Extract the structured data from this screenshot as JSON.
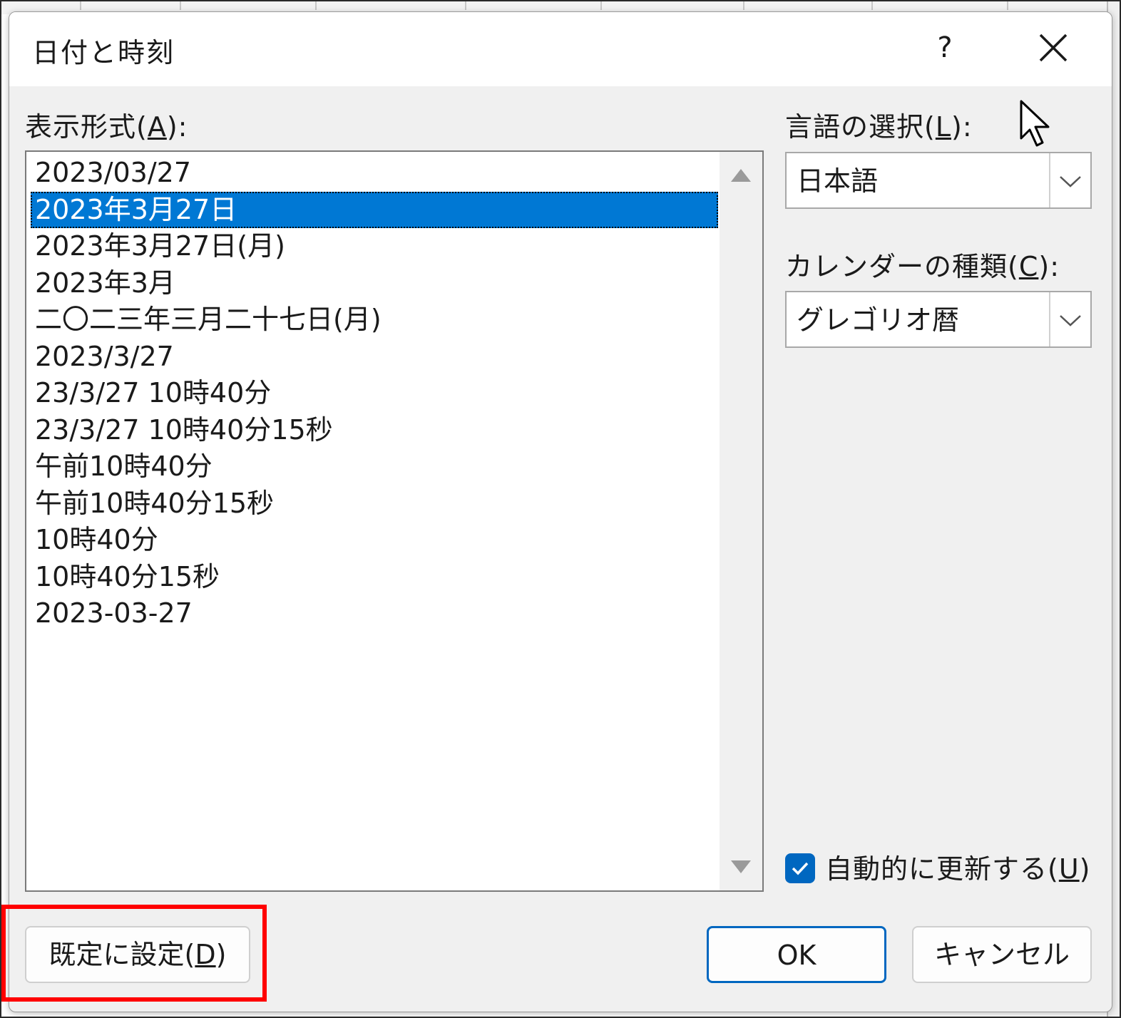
{
  "dialog": {
    "title": "日付と時刻",
    "help_label": "?"
  },
  "format_section": {
    "label_text": "表示形式(",
    "label_key": "A",
    "label_end": "):",
    "items": [
      "2023/03/27",
      "2023年3月27日",
      "2023年3月27日(月)",
      "2023年3月",
      "二〇二三年三月二十七日(月)",
      "2023/3/27",
      "23/3/27 10時40分",
      "23/3/27 10時40分15秒",
      "午前10時40分",
      "午前10時40分15秒",
      "10時40分",
      "10時40分15秒",
      "2023-03-27"
    ],
    "selected_index": 1
  },
  "language": {
    "label_text": "言語の選択(",
    "label_key": "L",
    "label_end": "):",
    "value": "日本語"
  },
  "calendar": {
    "label_text": "カレンダーの種類(",
    "label_key": "C",
    "label_end": "):",
    "value": "グレゴリオ暦"
  },
  "auto_update": {
    "label_text": "自動的に更新する(",
    "label_key": "U",
    "label_end": ")",
    "checked": true
  },
  "buttons": {
    "default_text": "既定に設定(",
    "default_key": "D",
    "default_end": ")",
    "ok": "OK",
    "cancel": "キャンセル"
  },
  "colors": {
    "selection": "#0078d4",
    "accent": "#0067c0",
    "highlight": "#ff0000"
  }
}
